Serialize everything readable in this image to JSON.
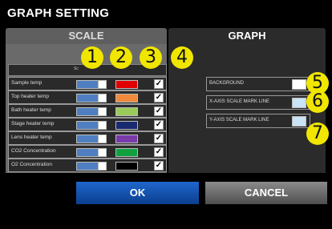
{
  "title": "GRAPH SETTING",
  "tabs": {
    "scale": "SCALE",
    "graph": "GRAPH"
  },
  "header": {
    "col1": "Sc",
    "col2": "",
    "col3": ""
  },
  "rows": [
    {
      "label": "Sample temp",
      "scale_color": "#4f7fc0",
      "graph_color": "#e00000",
      "checked": "✓"
    },
    {
      "label": "Top heater temp",
      "scale_color": "#4f7fc0",
      "graph_color": "#f08a3c",
      "checked": "✓"
    },
    {
      "label": "Bath heater temp",
      "scale_color": "#4f7fc0",
      "graph_color": "#9acb5a",
      "checked": "✓"
    },
    {
      "label": "Stage heater temp",
      "scale_color": "#4f7fc0",
      "graph_color": "#1a2a70",
      "checked": "✓"
    },
    {
      "label": "Lens heater temp",
      "scale_color": "#4f7fc0",
      "graph_color": "#7a3aa8",
      "checked": "✓"
    },
    {
      "label": "CO2 Concentration",
      "scale_color": "#4f7fc0",
      "graph_color": "#10a040",
      "checked": "✓"
    },
    {
      "label": "O2 Concentration",
      "scale_color": "#4f7fc0",
      "graph_color": "#000000",
      "checked": "✓"
    }
  ],
  "graph_rows": [
    {
      "label": "BACKGROUND",
      "color": "#ffffff"
    },
    {
      "label": "X-AXIS SCALE MARK LINE",
      "color": "#c8e4f5"
    },
    {
      "label": "Y-AXIS SCALE MARK LINE",
      "color": "#c8e4f5"
    }
  ],
  "badges": [
    "1",
    "2",
    "3",
    "4",
    "5",
    "6",
    "7"
  ],
  "buttons": {
    "ok": "OK",
    "cancel": "CANCEL"
  },
  "colors": {
    "badge": "#f0e600",
    "ok_button": "#1f66cc",
    "cancel_button": "#6a6a6a"
  }
}
